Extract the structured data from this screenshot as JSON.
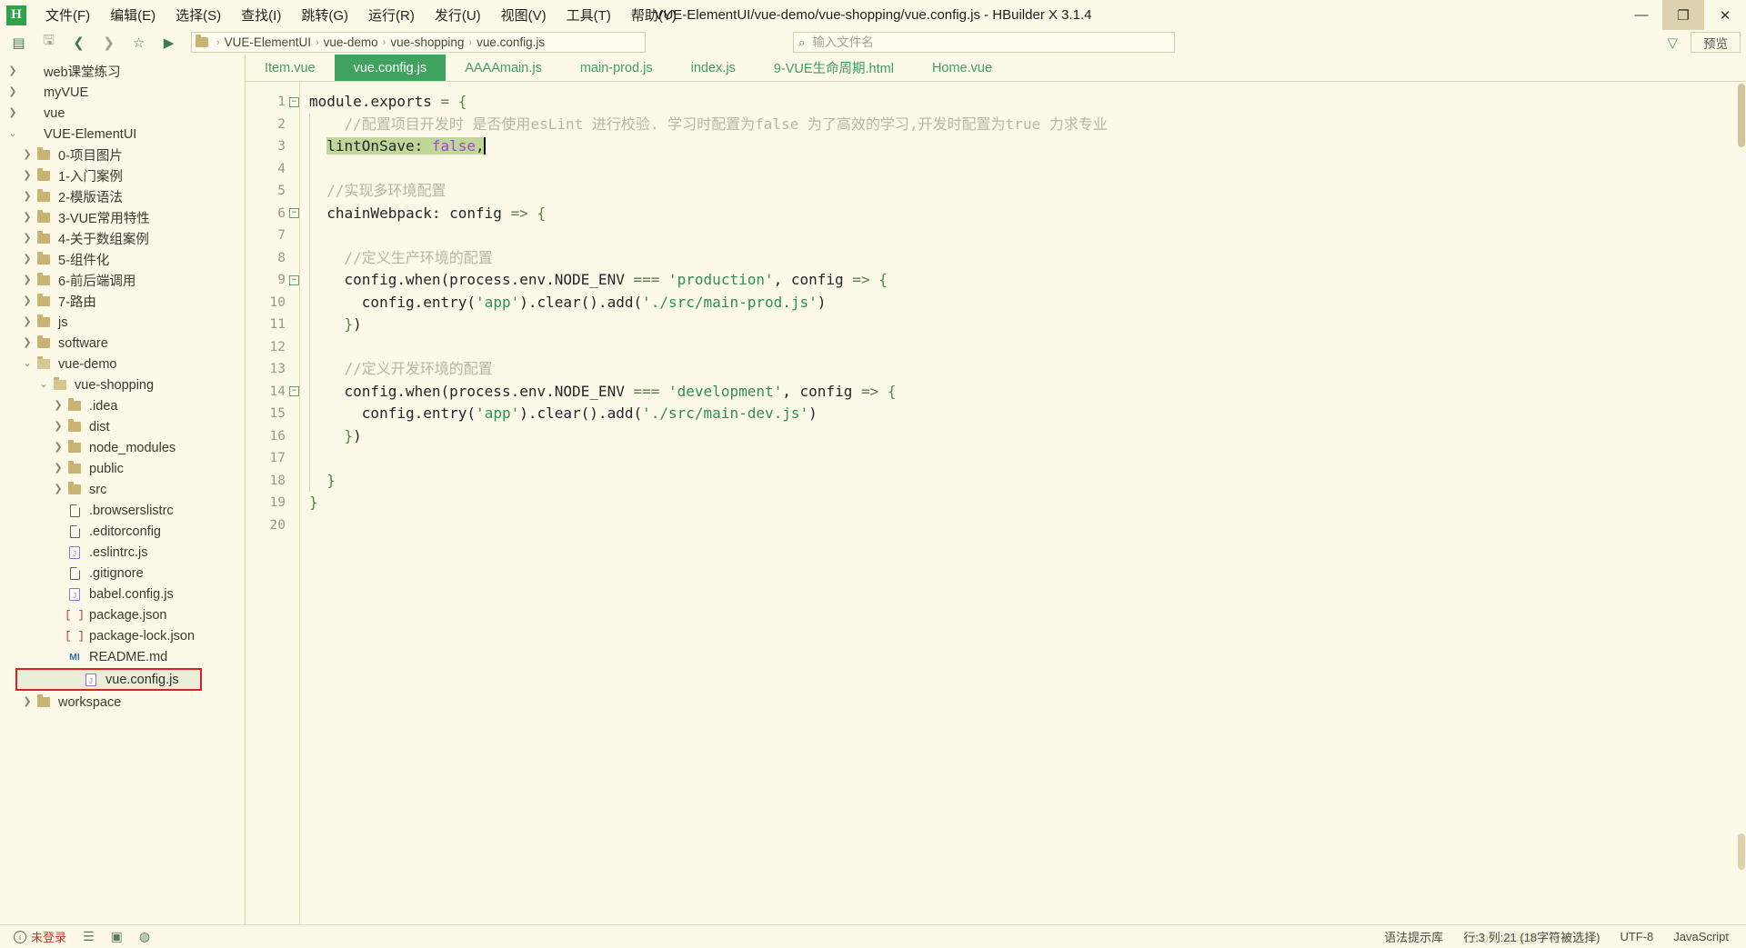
{
  "window": {
    "logo_text": "H",
    "title": "VUE-ElementUI/vue-demo/vue-shopping/vue.config.js - HBuilder X 3.1.4",
    "minimize": "—",
    "maximize": "❐",
    "close": "✕"
  },
  "menubar": [
    {
      "label": "文件(F)",
      "name": "menu-file"
    },
    {
      "label": "编辑(E)",
      "name": "menu-edit"
    },
    {
      "label": "选择(S)",
      "name": "menu-select"
    },
    {
      "label": "查找(I)",
      "name": "menu-find"
    },
    {
      "label": "跳转(G)",
      "name": "menu-goto"
    },
    {
      "label": "运行(R)",
      "name": "menu-run"
    },
    {
      "label": "发行(U)",
      "name": "menu-publish"
    },
    {
      "label": "视图(V)",
      "name": "menu-view"
    },
    {
      "label": "工具(T)",
      "name": "menu-tools"
    },
    {
      "label": "帮助(Y)",
      "name": "menu-help"
    }
  ],
  "toolbar": {
    "icons": [
      "新建",
      "保存",
      "后退",
      "前进",
      "收藏",
      "运行"
    ],
    "new_glyph": "▤",
    "save_glyph": "🖫",
    "back_glyph": "❮",
    "forward_glyph": "❯",
    "star_glyph": "☆",
    "run_glyph": "▶",
    "filter_glyph": "▽",
    "preview_label": "预览"
  },
  "breadcrumb": {
    "separator": "›",
    "items": [
      "VUE-ElementUI",
      "vue-demo",
      "vue-shopping",
      "vue.config.js"
    ]
  },
  "search": {
    "placeholder": "输入文件名",
    "value": "",
    "icon_glyph": "⌕"
  },
  "sidebar": {
    "items": [
      {
        "label": "web课堂练习",
        "depth": 0,
        "type": "folder",
        "state": "collapsed"
      },
      {
        "label": "myVUE",
        "depth": 0,
        "type": "folder",
        "state": "collapsed"
      },
      {
        "label": "vue",
        "depth": 0,
        "type": "folder",
        "state": "collapsed"
      },
      {
        "label": "VUE-ElementUI",
        "depth": 0,
        "type": "folder",
        "state": "expanded"
      },
      {
        "label": "0-项目图片",
        "depth": 1,
        "type": "folder",
        "state": "collapsed"
      },
      {
        "label": "1-入门案例",
        "depth": 1,
        "type": "folder",
        "state": "collapsed"
      },
      {
        "label": "2-模版语法",
        "depth": 1,
        "type": "folder",
        "state": "collapsed"
      },
      {
        "label": "3-VUE常用特性",
        "depth": 1,
        "type": "folder",
        "state": "collapsed"
      },
      {
        "label": "4-关于数组案例",
        "depth": 1,
        "type": "folder",
        "state": "collapsed"
      },
      {
        "label": "5-组件化",
        "depth": 1,
        "type": "folder",
        "state": "collapsed"
      },
      {
        "label": "6-前后端调用",
        "depth": 1,
        "type": "folder",
        "state": "collapsed"
      },
      {
        "label": "7-路由",
        "depth": 1,
        "type": "folder",
        "state": "collapsed"
      },
      {
        "label": "js",
        "depth": 1,
        "type": "folder",
        "state": "collapsed"
      },
      {
        "label": "software",
        "depth": 1,
        "type": "folder",
        "state": "collapsed"
      },
      {
        "label": "vue-demo",
        "depth": 1,
        "type": "folder",
        "state": "expanded"
      },
      {
        "label": "vue-shopping",
        "depth": 2,
        "type": "folder",
        "state": "expanded"
      },
      {
        "label": ".idea",
        "depth": 3,
        "type": "folder",
        "state": "collapsed"
      },
      {
        "label": "dist",
        "depth": 3,
        "type": "folder",
        "state": "collapsed"
      },
      {
        "label": "node_modules",
        "depth": 3,
        "type": "folder",
        "state": "collapsed"
      },
      {
        "label": "public",
        "depth": 3,
        "type": "folder",
        "state": "collapsed"
      },
      {
        "label": "src",
        "depth": 3,
        "type": "folder",
        "state": "collapsed"
      },
      {
        "label": ".browserslistrc",
        "depth": 3,
        "type": "file-plain"
      },
      {
        "label": ".editorconfig",
        "depth": 3,
        "type": "file-plain"
      },
      {
        "label": ".eslintrc.js",
        "depth": 3,
        "type": "file-js"
      },
      {
        "label": ".gitignore",
        "depth": 3,
        "type": "file-plain"
      },
      {
        "label": "babel.config.js",
        "depth": 3,
        "type": "file-js"
      },
      {
        "label": "package.json",
        "depth": 3,
        "type": "file-json",
        "badge": "[ ]"
      },
      {
        "label": "package-lock.json",
        "depth": 3,
        "type": "file-json",
        "badge": "[ ]"
      },
      {
        "label": "README.md",
        "depth": 3,
        "type": "file-md",
        "badge": "MI"
      },
      {
        "label": "vue.config.js",
        "depth": 3,
        "type": "file-js",
        "selected": true
      },
      {
        "label": "workspace",
        "depth": 1,
        "type": "folder",
        "state": "collapsed"
      }
    ]
  },
  "tabs": [
    {
      "label": "Item.vue",
      "active": false
    },
    {
      "label": "vue.config.js",
      "active": true
    },
    {
      "label": "AAAAmain.js",
      "active": false
    },
    {
      "label": "main-prod.js",
      "active": false
    },
    {
      "label": "index.js",
      "active": false
    },
    {
      "label": "9-VUE生命周期.html",
      "active": false
    },
    {
      "label": "Home.vue",
      "active": false
    }
  ],
  "code": {
    "line_numbers": [
      "1",
      "2",
      "3",
      "4",
      "5",
      "6",
      "7",
      "8",
      "9",
      "10",
      "11",
      "12",
      "13",
      "14",
      "15",
      "16",
      "17",
      "18",
      "19",
      "20"
    ],
    "lines": [
      "module.exports = {",
      "  //配置项目开发时 是否使用esLint 进行校验. 学习时配置为false 为了高效的学习,开发时配置为true 力求专业",
      "  lintOnSave: false,",
      "",
      "  //实现多环境配置",
      "  chainWebpack: config => {",
      "",
      "    //定义生产环境的配置",
      "    config.when(process.env.NODE_ENV === 'production', config => {",
      "      config.entry('app').clear().add('./src/main-prod.js')",
      "    })",
      "",
      "    //定义开发环境的配置",
      "    config.when(process.env.NODE_ENV === 'development', config => {",
      "      config.entry('app').clear().add('./src/main-dev.js')",
      "    })",
      "",
      "  }",
      "}",
      ""
    ],
    "selection_text": "lintOnSave: false,",
    "fold_markers": [
      1,
      6,
      9,
      14
    ]
  },
  "statusbar": {
    "login_text": "未登录",
    "icons": [
      "list-icon",
      "terminal-icon",
      "palette-icon"
    ],
    "list_glyph": "☰",
    "terminal_glyph": "▣",
    "palette_glyph": "◍",
    "syntax_hint": "语法提示库",
    "cursor_position": "行:3 列:21 (18字符被选择)",
    "encoding": "UTF-8",
    "language": "JavaScript",
    "watermark": "CSDN @浮生半日闲"
  },
  "colors": {
    "bg": "#fdf9e8",
    "accent_green": "#3fa25f",
    "tab_text": "#3e9e5f",
    "selection": "#bfd89a",
    "comment": "#b9b5a0",
    "string": "#2c8f5a",
    "bool": "#a246d6",
    "red_outline": "#e02020"
  }
}
